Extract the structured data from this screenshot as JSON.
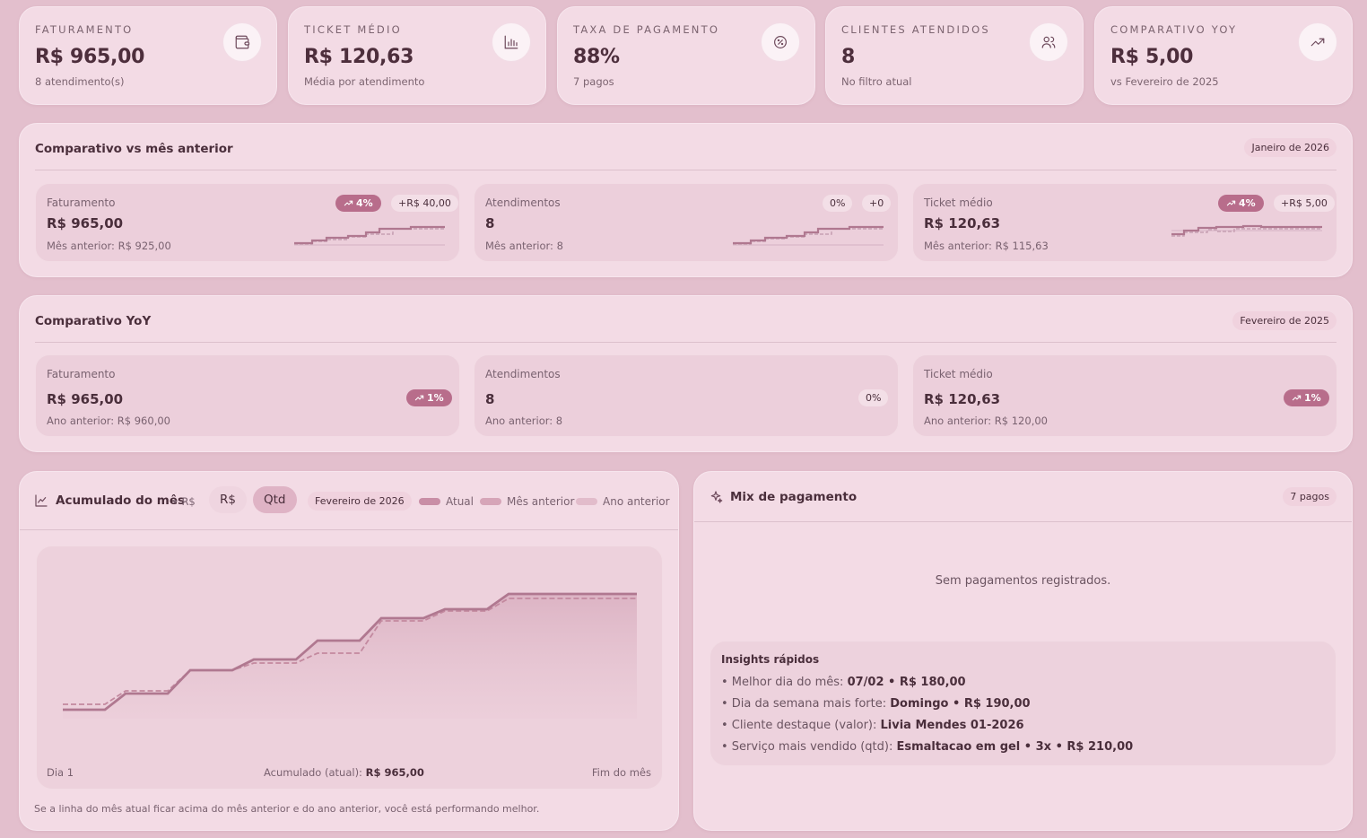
{
  "kpis": [
    {
      "label": "FATURAMENTO",
      "value": "R$ 965,00",
      "sub": "8 atendimento(s)",
      "icon": "wallet-icon"
    },
    {
      "label": "TICKET MÉDIO",
      "value": "R$ 120,63",
      "sub": "Média por atendimento",
      "icon": "bar-chart-icon"
    },
    {
      "label": "TAXA DE PAGAMENTO",
      "value": "88%",
      "sub": "7 pagos",
      "icon": "badge-percent-icon"
    },
    {
      "label": "CLIENTES ATENDIDOS",
      "value": "8",
      "sub": "No filtro atual",
      "icon": "users-icon"
    },
    {
      "label": "COMPARATIVO YOY",
      "value": "R$ 5,00",
      "sub": "vs Fevereiro de 2025",
      "icon": "trending-up-icon"
    }
  ],
  "mom": {
    "title": "Comparativo vs mês anterior",
    "period": "Janeiro de 2026",
    "cards": [
      {
        "label": "Faturamento",
        "value": "R$ 965,00",
        "prev": "Mês anterior: R$ 925,00",
        "pct": "4%",
        "delta": "+R$ 40,00"
      },
      {
        "label": "Atendimentos",
        "value": "8",
        "prev": "Mês anterior: 8",
        "pct": "0%",
        "delta": "+0"
      },
      {
        "label": "Ticket médio",
        "value": "R$ 120,63",
        "prev": "Mês anterior: R$ 115,63",
        "pct": "4%",
        "delta": "+R$ 5,00"
      }
    ]
  },
  "yoy": {
    "title": "Comparativo YoY",
    "period": "Fevereiro de 2025",
    "cards": [
      {
        "label": "Faturamento",
        "value": "R$ 965,00",
        "prev": "Ano anterior: R$ 960,00",
        "pct": "1%"
      },
      {
        "label": "Atendimentos",
        "value": "8",
        "prev": "Ano anterior: 8",
        "pct": "0%"
      },
      {
        "label": "Ticket médio",
        "value": "R$ 120,63",
        "prev": "Ano anterior: R$ 120,00",
        "pct": "1%"
      }
    ]
  },
  "accum": {
    "title": "Acumulado do mês",
    "unit": "• R$",
    "btn_rs": "R$",
    "btn_qtd": "Qtd",
    "period": "Fevereiro de 2026",
    "legend_current": "Atual",
    "legend_prev_month": "Mês anterior",
    "legend_prev_year": "Ano anterior",
    "x_start": "Dia 1",
    "x_end": "Fim do mês",
    "total_label": "Acumulado (atual):",
    "total_value": "R$ 965,00",
    "footnote": "Se a linha do mês atual ficar acima do mês anterior e do ano anterior, você está performando melhor."
  },
  "mix": {
    "title": "Mix de pagamento",
    "badge": "7 pagos",
    "empty": "Sem pagamentos registrados.",
    "insights_title": "Insights rápidos",
    "insights": [
      {
        "label": "• Melhor dia do mês:",
        "value": "07/02 • R$ 180,00"
      },
      {
        "label": "• Dia da semana mais forte:",
        "value": "Domingo • R$ 190,00"
      },
      {
        "label": "• Cliente destaque (valor):",
        "value": "Livia Mendes 01-2026"
      },
      {
        "label": "• Serviço mais vendido (qtd):",
        "value": "Esmaltacao em gel • 3x • R$ 210,00"
      }
    ]
  },
  "colors": {
    "accent": "#b86d8b",
    "line_current": "#b07890",
    "line_prev": "#c3899f"
  }
}
